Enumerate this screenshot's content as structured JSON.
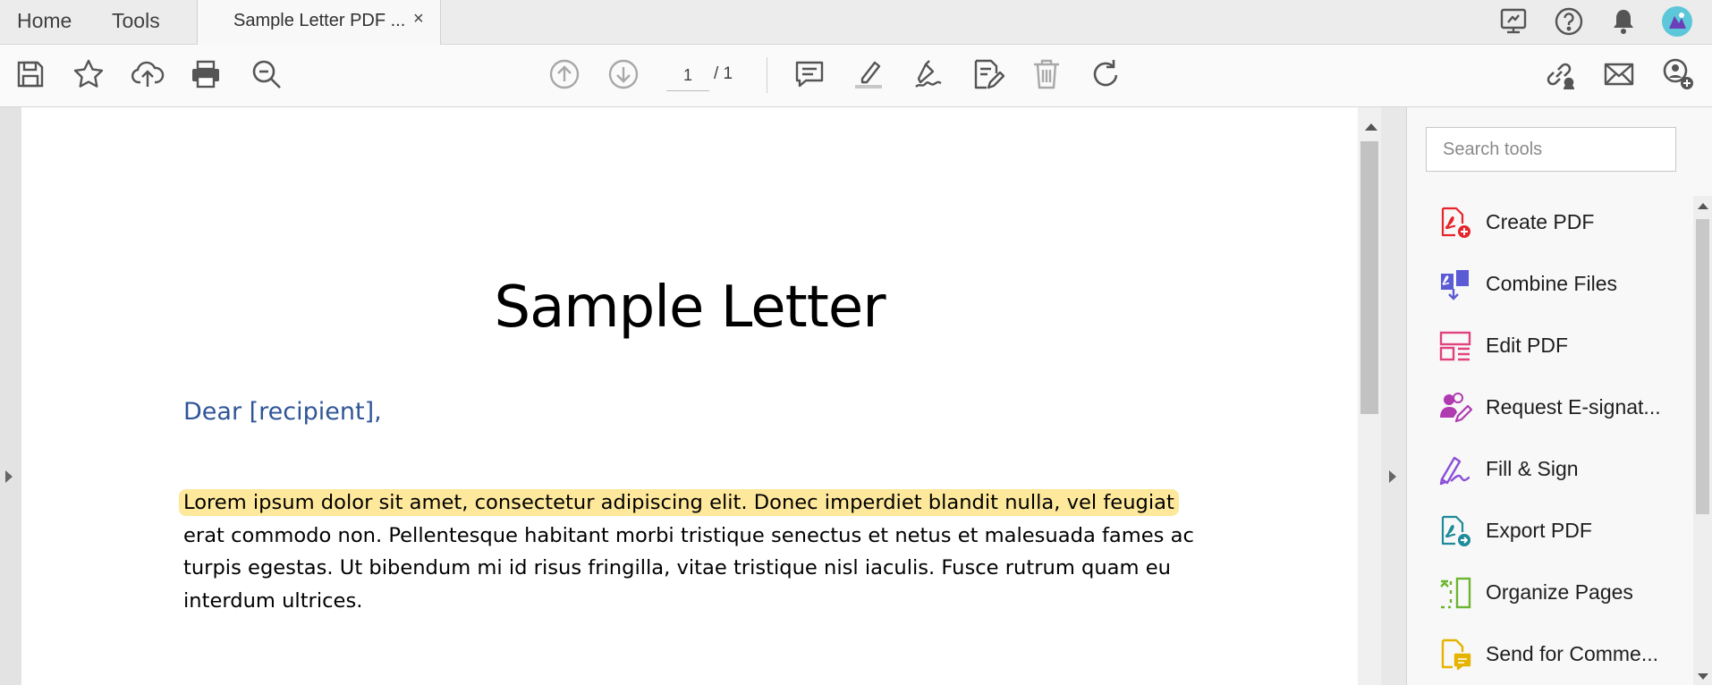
{
  "tabs": {
    "home": "Home",
    "tools": "Tools",
    "document_tab": "Sample Letter PDF ...",
    "close": "×"
  },
  "header_icons": [
    "share-screen-icon",
    "help-icon",
    "bell-icon",
    "user-avatar"
  ],
  "toolbar": {
    "left_icons": [
      "save-icon",
      "star-icon",
      "cloud-upload-icon",
      "print-icon",
      "zoom-search-icon"
    ],
    "page_current": "1",
    "page_total": "/ 1",
    "center_icons": [
      "previous-page-icon",
      "next-page-icon",
      "comment-icon",
      "highlight-icon",
      "sign-icon",
      "edit-text-icon",
      "delete-icon",
      "rotate-icon"
    ],
    "right_icons": [
      "share-link-icon",
      "email-icon",
      "add-user-icon"
    ]
  },
  "document": {
    "title": "Sample Letter",
    "greeting": "Dear [recipient],",
    "highlighted_text": "Lorem ipsum dolor sit amet, consectetur adipiscing elit. Donec imperdiet blandit nulla, vel feugiat",
    "body_lines": [
      "erat commodo non. Pellentesque habitant morbi tristique senectus et netus et malesuada fames ac",
      "turpis egestas. Ut bibendum mi id risus fringilla, vitae tristique nisl iaculis. Fusce rutrum quam eu",
      "interdum ultrices."
    ],
    "highlight_color": "#fde89b",
    "greeting_color": "#2f5597"
  },
  "tools_pane": {
    "search_placeholder": "Search tools",
    "tools": [
      {
        "label": "Create PDF",
        "icon": "create-pdf-icon",
        "color": "#e5252a"
      },
      {
        "label": "Combine Files",
        "icon": "combine-files-icon",
        "color": "#5b5bd6"
      },
      {
        "label": "Edit PDF",
        "icon": "edit-pdf-icon",
        "color": "#e0427e"
      },
      {
        "label": "Request E-signat...",
        "icon": "request-esign-icon",
        "color": "#b03ab0"
      },
      {
        "label": "Fill & Sign",
        "icon": "fill-sign-icon",
        "color": "#8a4fd8"
      },
      {
        "label": "Export PDF",
        "icon": "export-pdf-icon",
        "color": "#1e8a9a"
      },
      {
        "label": "Organize Pages",
        "icon": "organize-pages-icon",
        "color": "#6bb52f"
      },
      {
        "label": "Send for Comme...",
        "icon": "send-for-comment-icon",
        "color": "#e4b400"
      }
    ]
  }
}
